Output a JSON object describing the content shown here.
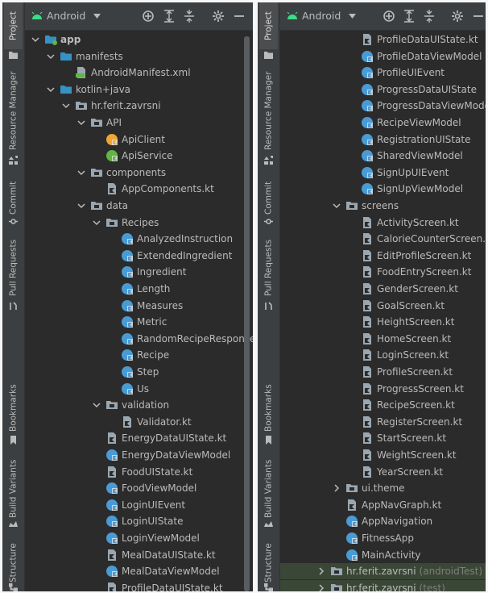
{
  "toolbar": {
    "android_label": "Android"
  },
  "side_tabs": {
    "project": "Project",
    "resource_manager": "Resource Manager",
    "commit": "Commit",
    "pull_requests": "Pull Requests",
    "bookmarks": "Bookmarks",
    "build_variants": "Build Variants",
    "structure": "Structure"
  },
  "colors": {
    "panel_bg": "#2b2b2b",
    "toolbar_bg": "#3c3f41",
    "text": "#bbbbbb",
    "folder_blue": "#3592c4",
    "kotlin_file_gray": "#9aa7b0",
    "class_blue": "#4a9bd4",
    "interface_green": "#62b543",
    "object_orange": "#f0a732",
    "selection_green": "#3b4736",
    "android_green": "#3ddc84"
  },
  "left_tree": [
    {
      "depth": 0,
      "chev": "down",
      "icon": "module-folder-icon",
      "label": "app",
      "bold": true
    },
    {
      "depth": 1,
      "chev": "down",
      "icon": "folder-icon",
      "label": "manifests"
    },
    {
      "depth": 2,
      "chev": "none",
      "icon": "manifest-file-icon",
      "label": "AndroidManifest.xml"
    },
    {
      "depth": 1,
      "chev": "down",
      "icon": "folder-icon",
      "label": "kotlin+java"
    },
    {
      "depth": 2,
      "chev": "down",
      "icon": "package-icon",
      "label": "hr.ferit.zavrsni"
    },
    {
      "depth": 3,
      "chev": "down",
      "icon": "package-icon",
      "label": "API"
    },
    {
      "depth": 4,
      "chev": "none",
      "icon": "kotlin-object-icon",
      "label": "ApiClient"
    },
    {
      "depth": 4,
      "chev": "none",
      "icon": "kotlin-interface-icon",
      "label": "ApiService"
    },
    {
      "depth": 3,
      "chev": "down",
      "icon": "package-icon",
      "label": "components"
    },
    {
      "depth": 4,
      "chev": "none",
      "icon": "kotlin-file-icon",
      "label": "AppComponents.kt"
    },
    {
      "depth": 3,
      "chev": "down",
      "icon": "package-icon",
      "label": "data"
    },
    {
      "depth": 4,
      "chev": "down",
      "icon": "package-icon",
      "label": "Recipes"
    },
    {
      "depth": 5,
      "chev": "none",
      "icon": "kotlin-class-icon",
      "label": "AnalyzedInstruction"
    },
    {
      "depth": 5,
      "chev": "none",
      "icon": "kotlin-class-icon",
      "label": "ExtendedIngredient"
    },
    {
      "depth": 5,
      "chev": "none",
      "icon": "kotlin-class-icon",
      "label": "Ingredient"
    },
    {
      "depth": 5,
      "chev": "none",
      "icon": "kotlin-class-icon",
      "label": "Length"
    },
    {
      "depth": 5,
      "chev": "none",
      "icon": "kotlin-class-icon",
      "label": "Measures"
    },
    {
      "depth": 5,
      "chev": "none",
      "icon": "kotlin-class-icon",
      "label": "Metric"
    },
    {
      "depth": 5,
      "chev": "none",
      "icon": "kotlin-class-icon",
      "label": "RandomRecipeResponse"
    },
    {
      "depth": 5,
      "chev": "none",
      "icon": "kotlin-class-icon",
      "label": "Recipe"
    },
    {
      "depth": 5,
      "chev": "none",
      "icon": "kotlin-class-icon",
      "label": "Step"
    },
    {
      "depth": 5,
      "chev": "none",
      "icon": "kotlin-class-icon",
      "label": "Us"
    },
    {
      "depth": 4,
      "chev": "down",
      "icon": "package-icon",
      "label": "validation"
    },
    {
      "depth": 5,
      "chev": "none",
      "icon": "kotlin-file-icon",
      "label": "Validator.kt"
    },
    {
      "depth": 4,
      "chev": "none",
      "icon": "kotlin-file-icon",
      "label": "EnergyDataUIState.kt"
    },
    {
      "depth": 4,
      "chev": "none",
      "icon": "kotlin-class-icon",
      "label": "EnergyDataViewModel"
    },
    {
      "depth": 4,
      "chev": "none",
      "icon": "kotlin-file-icon",
      "label": "FoodUIState.kt"
    },
    {
      "depth": 4,
      "chev": "none",
      "icon": "kotlin-class-icon",
      "label": "FoodViewModel"
    },
    {
      "depth": 4,
      "chev": "none",
      "icon": "kotlin-class-icon",
      "label": "LoginUIEvent"
    },
    {
      "depth": 4,
      "chev": "none",
      "icon": "kotlin-class-icon",
      "label": "LoginUIState"
    },
    {
      "depth": 4,
      "chev": "none",
      "icon": "kotlin-class-icon",
      "label": "LoginViewModel"
    },
    {
      "depth": 4,
      "chev": "none",
      "icon": "kotlin-file-icon",
      "label": "MealDataUIState.kt"
    },
    {
      "depth": 4,
      "chev": "none",
      "icon": "kotlin-class-icon",
      "label": "MealDataViewModel"
    },
    {
      "depth": 4,
      "chev": "none",
      "icon": "kotlin-file-icon",
      "label": "ProfileDataUIState.kt"
    }
  ],
  "right_tree": [
    {
      "depth": 4,
      "chev": "none",
      "icon": "kotlin-file-icon",
      "label": "ProfileDataUIState.kt"
    },
    {
      "depth": 4,
      "chev": "none",
      "icon": "kotlin-class-icon",
      "label": "ProfileDataViewModel"
    },
    {
      "depth": 4,
      "chev": "none",
      "icon": "kotlin-class-icon",
      "label": "ProfileUIEvent"
    },
    {
      "depth": 4,
      "chev": "none",
      "icon": "kotlin-class-icon",
      "label": "ProgressDataUIState"
    },
    {
      "depth": 4,
      "chev": "none",
      "icon": "kotlin-class-icon",
      "label": "ProgressDataViewModel"
    },
    {
      "depth": 4,
      "chev": "none",
      "icon": "kotlin-class-icon",
      "label": "RecipeViewModel"
    },
    {
      "depth": 4,
      "chev": "none",
      "icon": "kotlin-class-icon",
      "label": "RegistrationUIState"
    },
    {
      "depth": 4,
      "chev": "none",
      "icon": "kotlin-class-icon",
      "label": "SharedViewModel"
    },
    {
      "depth": 4,
      "chev": "none",
      "icon": "kotlin-class-icon",
      "label": "SignUpUIEvent"
    },
    {
      "depth": 4,
      "chev": "none",
      "icon": "kotlin-class-icon",
      "label": "SignUpViewModel"
    },
    {
      "depth": 3,
      "chev": "down",
      "icon": "package-icon",
      "label": "screens"
    },
    {
      "depth": 4,
      "chev": "none",
      "icon": "kotlin-file-icon",
      "label": "ActivityScreen.kt"
    },
    {
      "depth": 4,
      "chev": "none",
      "icon": "kotlin-file-icon",
      "label": "CalorieCounterScreen.kt"
    },
    {
      "depth": 4,
      "chev": "none",
      "icon": "kotlin-file-icon",
      "label": "EditProfileScreen.kt"
    },
    {
      "depth": 4,
      "chev": "none",
      "icon": "kotlin-file-icon",
      "label": "FoodEntryScreen.kt"
    },
    {
      "depth": 4,
      "chev": "none",
      "icon": "kotlin-file-icon",
      "label": "GenderScreen.kt"
    },
    {
      "depth": 4,
      "chev": "none",
      "icon": "kotlin-file-icon",
      "label": "GoalScreen.kt"
    },
    {
      "depth": 4,
      "chev": "none",
      "icon": "kotlin-file-icon",
      "label": "HeightScreen.kt"
    },
    {
      "depth": 4,
      "chev": "none",
      "icon": "kotlin-file-icon",
      "label": "HomeScreen.kt"
    },
    {
      "depth": 4,
      "chev": "none",
      "icon": "kotlin-file-icon",
      "label": "LoginScreen.kt"
    },
    {
      "depth": 4,
      "chev": "none",
      "icon": "kotlin-file-icon",
      "label": "ProfileScreen.kt"
    },
    {
      "depth": 4,
      "chev": "none",
      "icon": "kotlin-file-icon",
      "label": "ProgressScreen.kt"
    },
    {
      "depth": 4,
      "chev": "none",
      "icon": "kotlin-file-icon",
      "label": "RecipeScreen.kt"
    },
    {
      "depth": 4,
      "chev": "none",
      "icon": "kotlin-file-icon",
      "label": "RegisterScreen.kt"
    },
    {
      "depth": 4,
      "chev": "none",
      "icon": "kotlin-file-icon",
      "label": "StartScreen.kt"
    },
    {
      "depth": 4,
      "chev": "none",
      "icon": "kotlin-file-icon",
      "label": "WeightScreen.kt"
    },
    {
      "depth": 4,
      "chev": "none",
      "icon": "kotlin-file-icon",
      "label": "YearScreen.kt"
    },
    {
      "depth": 3,
      "chev": "right",
      "icon": "package-icon",
      "label": "ui.theme"
    },
    {
      "depth": 3,
      "chev": "none",
      "icon": "kotlin-file-icon",
      "label": "AppNavGraph.kt"
    },
    {
      "depth": 3,
      "chev": "none",
      "icon": "kotlin-class-icon",
      "label": "AppNavigation"
    },
    {
      "depth": 3,
      "chev": "none",
      "icon": "kotlin-class-icon",
      "label": "FitnessApp"
    },
    {
      "depth": 3,
      "chev": "none",
      "icon": "kotlin-class-icon",
      "label": "MainActivity"
    },
    {
      "depth": 2,
      "chev": "right",
      "icon": "package-icon",
      "label": "hr.ferit.zavrsni",
      "suffix": "(androidTest)",
      "highlight": true
    },
    {
      "depth": 2,
      "chev": "right",
      "icon": "package-icon",
      "label": "hr.ferit.zavrsni",
      "suffix": "(test)",
      "highlight": true
    }
  ]
}
